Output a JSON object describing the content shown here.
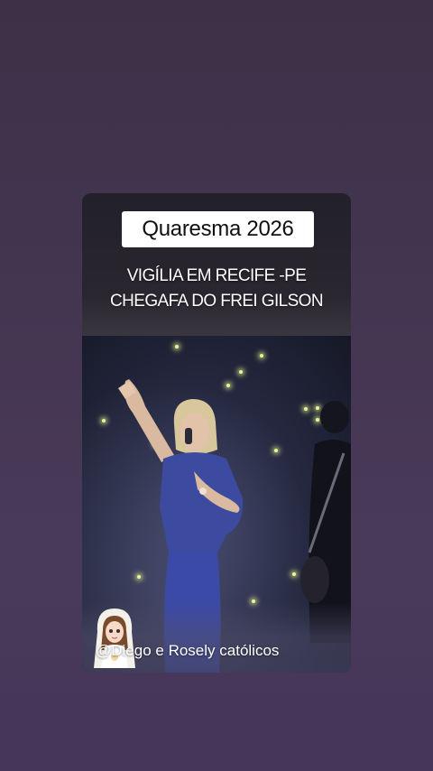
{
  "post": {
    "title_badge": "Quaresma 2026",
    "subtitle_line1": "VIGÍLIA EM RECIFE -PE",
    "subtitle_line2": "CHEGAFA DO FREI GILSON",
    "user_handle": "@Diego e Rosely católicos"
  },
  "colors": {
    "background": "#443551",
    "badge_background": "#ffffff",
    "star_light": "#e8f49a",
    "singer_dress": "#3c4aa0"
  },
  "icons": {
    "avatar": "saint-avatar-icon"
  }
}
